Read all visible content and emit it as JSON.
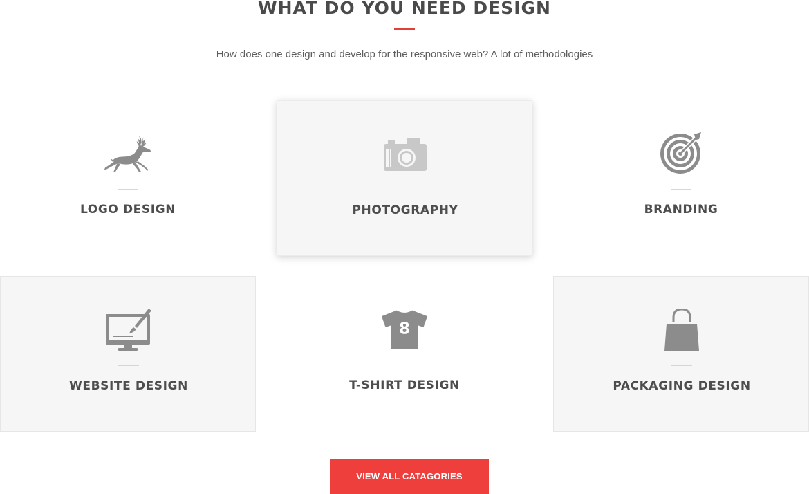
{
  "section": {
    "title": "WHAT DO YOU NEED DESIGN",
    "subtitle": "How does one design and develop for the responsive web? A lot of methodologies",
    "accent_color": "#e03f3a"
  },
  "cards": [
    {
      "label": "LOGO DESIGN",
      "icon": "deer-icon"
    },
    {
      "label": "PHOTOGRAPHY",
      "icon": "camera-icon"
    },
    {
      "label": "BRANDING",
      "icon": "target-icon"
    },
    {
      "label": "WEBSITE DESIGN",
      "icon": "monitor-brush-icon"
    },
    {
      "label": "T-SHIRT DESIGN",
      "icon": "tshirt-icon",
      "icon_text": "8"
    },
    {
      "label": "PACKAGING DESIGN",
      "icon": "shopping-bag-icon"
    }
  ],
  "cta": {
    "label": "VIEW ALL CATAGORIES",
    "color": "#ee3f3c"
  },
  "colors": {
    "icon_gray": "#8c8c8c",
    "card_bg": "#f6f6f6"
  }
}
